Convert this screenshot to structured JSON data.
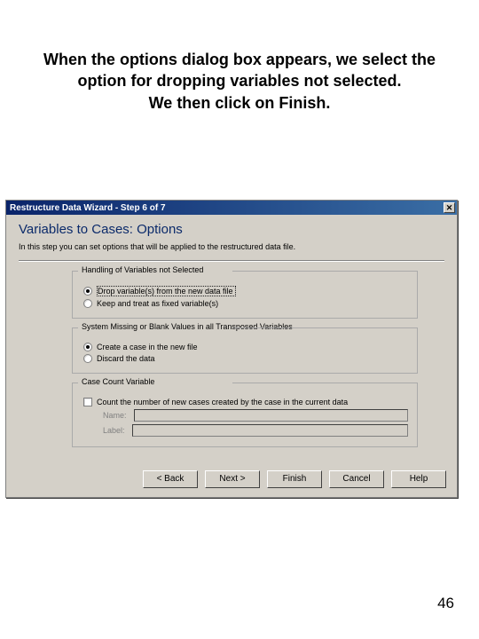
{
  "caption": {
    "line1": "When the options dialog box appears, we select the",
    "line2": "option for dropping variables not selected.",
    "line3": "We then click on Finish."
  },
  "dialog": {
    "title": "Restructure Data Wizard - Step 6 of 7",
    "heading": "Variables to Cases: Options",
    "subtitle": "In this step you can set options that will be applied to the restructured data file.",
    "group1": {
      "label": "Handling of Variables not Selected",
      "opt1": "Drop variable(s) from the new data file",
      "opt2": "Keep and treat as fixed variable(s)"
    },
    "group2": {
      "label": "System Missing or Blank Values in all Transposed Variables",
      "opt1": "Create a case in the new file",
      "opt2": "Discard the data"
    },
    "group3": {
      "label": "Case Count Variable",
      "check": "Count the number of new cases created by the case in the current data",
      "name_lbl": "Name:",
      "label_lbl": "Label:"
    },
    "buttons": {
      "back": "< Back",
      "next": "Next >",
      "finish": "Finish",
      "cancel": "Cancel",
      "help": "Help"
    }
  },
  "page_number": "46"
}
